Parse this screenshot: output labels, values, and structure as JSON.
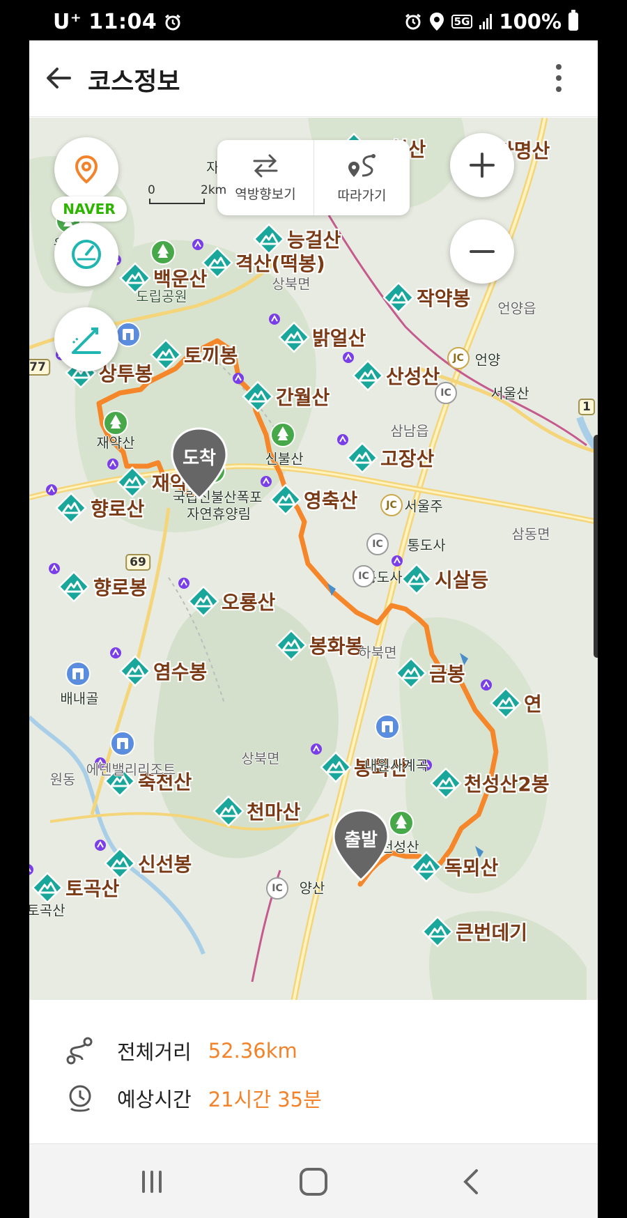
{
  "status_bar": {
    "carrier": "U⁺",
    "time": "11:04",
    "network": "5G",
    "battery": "100%"
  },
  "header": {
    "title": "코스정보"
  },
  "map_controls": {
    "reverse_label": "역방향보기",
    "follow_label": "따라가기",
    "zoom_in": "+",
    "zoom_out": "−"
  },
  "map": {
    "mountains": [
      {
        "name": "백운산"
      },
      {
        "name": "격산(떡봉)"
      },
      {
        "name": "작약봉"
      },
      {
        "name": "밝얼산"
      },
      {
        "name": "토끼봉"
      },
      {
        "name": "상투봉"
      },
      {
        "name": "산성산"
      },
      {
        "name": "간월산"
      },
      {
        "name": "고장산"
      },
      {
        "name": "재약봉"
      },
      {
        "name": "영축산"
      },
      {
        "name": "향로산"
      },
      {
        "name": "향로봉"
      },
      {
        "name": "오룡산"
      },
      {
        "name": "시살등"
      },
      {
        "name": "봉화봉"
      },
      {
        "name": "염수봉"
      },
      {
        "name": "금봉"
      },
      {
        "name": "연"
      },
      {
        "name": "봉화산"
      },
      {
        "name": "축천산"
      },
      {
        "name": "천마산"
      },
      {
        "name": "천성산2봉"
      },
      {
        "name": "신선봉"
      },
      {
        "name": "독뫼산"
      },
      {
        "name": "토곡산"
      },
      {
        "name": "큰번데기"
      },
      {
        "name": "능걸산"
      },
      {
        "name": "마명산"
      },
      {
        "name": "고헌산"
      }
    ],
    "places": [
      {
        "name": "운문산"
      },
      {
        "name": "자연휴양림"
      },
      {
        "name": "도립공원"
      },
      {
        "name": "상북면"
      },
      {
        "name": "언양읍"
      },
      {
        "name": "언양"
      },
      {
        "name": "서울산"
      },
      {
        "name": "삼남읍"
      },
      {
        "name": "재약산"
      },
      {
        "name": "신불산"
      },
      {
        "name": "국립신불산폭포"
      },
      {
        "name": "자연휴양림"
      },
      {
        "name": "서울주"
      },
      {
        "name": "통도사"
      },
      {
        "name": "통도사"
      },
      {
        "name": "삼동면"
      },
      {
        "name": "하북면"
      },
      {
        "name": "배내골"
      },
      {
        "name": "내원사계곡"
      },
      {
        "name": "원동"
      },
      {
        "name": "에덴밸리리조트"
      },
      {
        "name": "상북면"
      },
      {
        "name": "천성산"
      },
      {
        "name": "양산"
      },
      {
        "name": "토곡산"
      }
    ],
    "road_numbers": [
      "77",
      "69",
      "1"
    ],
    "start_pin": "출발",
    "end_pin": "도착",
    "logo": "NAVER",
    "scale_zero": "0",
    "scale_label": "2km",
    "route_color": "#f5862a"
  },
  "course_info": {
    "distance_label": "전체거리",
    "distance_value": "52.36km",
    "time_label": "예상시간",
    "time_value": "21시간 35분",
    "accent": "#f2832a"
  }
}
